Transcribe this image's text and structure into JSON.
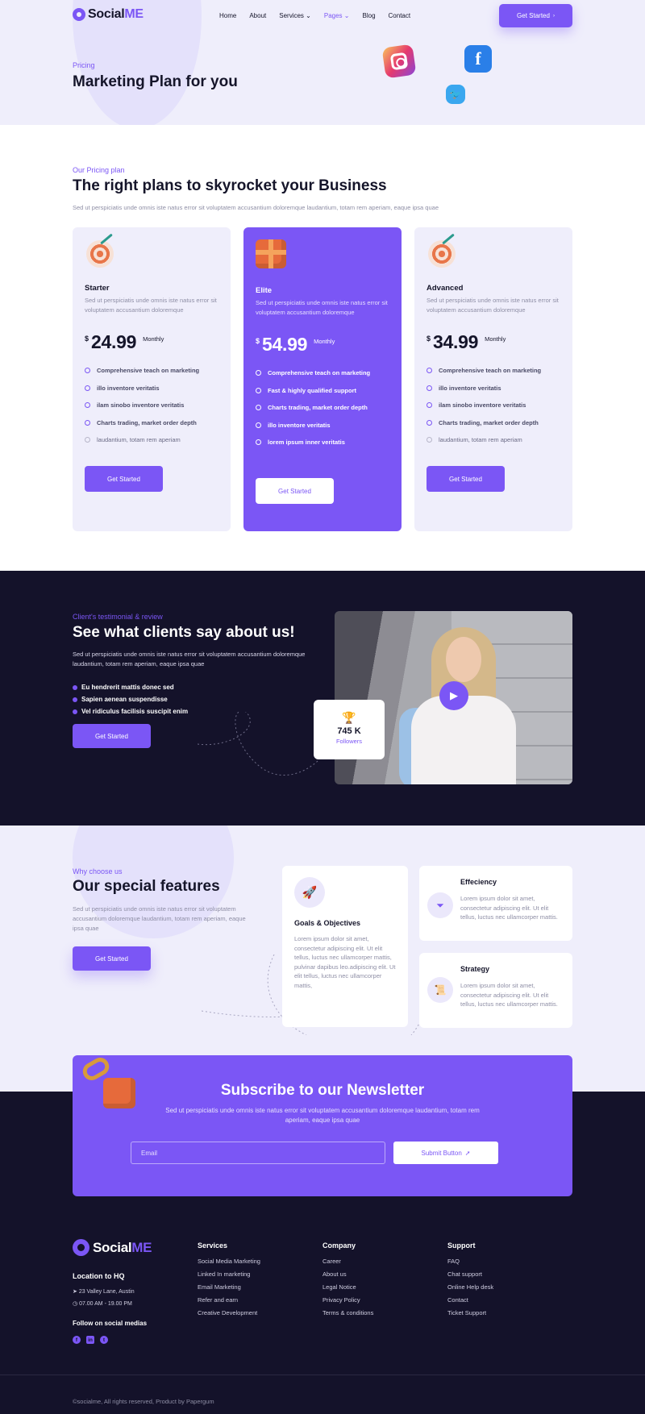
{
  "header": {
    "logo_main": "Social",
    "logo_accent": "ME",
    "menu": [
      "Home",
      "About",
      "Services",
      "Pages",
      "Blog",
      "Contact"
    ],
    "cta": "Get Started"
  },
  "hero": {
    "label": "Pricing",
    "title": "Marketing Plan for you"
  },
  "pricing": {
    "label": "Our Pricing plan",
    "title": "The right plans to skyrocket your Business",
    "subtitle": "Sed ut perspiciatis unde omnis iste natus error sit voluptatem accusantium doloremque laudantium, totam rem aperiam, eaque ipsa quae",
    "plans": [
      {
        "name": "Starter",
        "desc": "Sed ut perspiciatis unde omnis iste natus error sit voluptatem accusantium doloremque",
        "currency": "$",
        "price": "24.99",
        "period": "Monthly",
        "features": [
          "Comprehensive teach on marketing",
          "illo inventore veritatis",
          "ilam sinobo inventore veritatis",
          "Charts trading, market order depth",
          "laudantium, totam rem aperiam"
        ],
        "button": "Get Started"
      },
      {
        "name": "Elite",
        "desc": "Sed ut perspiciatis unde omnis iste natus error sit voluptatem accusantium doloremque",
        "currency": "$",
        "price": "54.99",
        "period": "Monthly",
        "features": [
          "Comprehensive teach on marketing",
          "Fast & highly qualified support",
          "Charts trading, market order depth",
          "illo inventore veritatis",
          "lorem ipsum inner veritatis"
        ],
        "button": "Get Started"
      },
      {
        "name": "Advanced",
        "desc": "Sed ut perspiciatis unde omnis iste natus error sit voluptatem accusantium doloremque",
        "currency": "$",
        "price": "34.99",
        "period": "Monthly",
        "features": [
          "Comprehensive teach on marketing",
          "illo inventore veritatis",
          "ilam sinobo inventore veritatis",
          "Charts trading, market order depth",
          "laudantium, totam rem aperiam"
        ],
        "button": "Get Started"
      }
    ]
  },
  "testimonial": {
    "label": "Client's testimonial & review",
    "title": "See what clients say about us!",
    "subtitle": "Sed ut perspiciatis unde omnis iste natus error sit voluptatem accusantium doloremque laudantium, totam rem aperiam, eaque ipsa quae",
    "bullets": [
      "Eu hendrerit mattis donec sed",
      "Sapien aenean suspendisse",
      "Vel ridiculus facilisis suscipit enim"
    ],
    "button": "Get Started",
    "followers_count": "745 K",
    "followers_label": "Followers"
  },
  "features": {
    "label": "Why choose us",
    "title": "Our special features",
    "subtitle": "Sed ut perspiciatis unde omnis iste natus error sit voluptatem accusantium doloremque laudantium, totam rem aperiam, eaque ipsa quae",
    "button": "Get Started",
    "items": [
      {
        "title": "Goals & Objectives",
        "desc": "Lorem ipsum dolor sit amet, consectetur adipiscing elit. Ut elit tellus, luctus nec ullamcorper mattis, pulvinar dapibus leo.adipiscing elit. Ut elit tellus, luctus nec ullamcorper mattis,"
      },
      {
        "title": "Effeciency",
        "desc": "Lorem ipsum dolor sit amet, consectetur adipiscing elit. Ut elit tellus, luctus nec ullamcorper mattis."
      },
      {
        "title": "Strategy",
        "desc": "Lorem ipsum dolor sit amet, consectetur adipiscing elit. Ut elit tellus, luctus nec ullamcorper mattis."
      }
    ]
  },
  "newsletter": {
    "title": "Subscribe to our Newsletter",
    "subtitle": "Sed ut perspiciatis unde omnis iste natus error sit voluptatem accusantium doloremque laudantium, totam rem aperiam, eaque ipsa quae",
    "placeholder": "Email",
    "button": "Submit Button"
  },
  "footer": {
    "location_title": "Location to HQ",
    "address": "23 Valley Lane, Austin",
    "hours": "07.00 AM - 19.00 PM",
    "follow_title": "Follow on social medias",
    "columns": [
      {
        "title": "Services",
        "links": [
          "Social Media Marketing",
          "Linked In marketing",
          "Email Marketing",
          "Refer and earn",
          "Creative Development"
        ]
      },
      {
        "title": "Company",
        "links": [
          "Career",
          "About us",
          "Legal Notice",
          "Privacy Policy",
          "Terms & conditions"
        ]
      },
      {
        "title": "Support",
        "links": [
          "FAQ",
          "Chat support",
          "Online Help desk",
          "Contact",
          "Ticket Support"
        ]
      }
    ],
    "copyright": "©socialme, All rights reserved, Product by Papergum"
  },
  "colors": {
    "accent": "#7b56f5",
    "dark": "#14122a",
    "light_bg": "#efeefb"
  },
  "icons": [
    "instagram-icon",
    "facebook-icon",
    "twitter-icon",
    "target-icon",
    "gift-box-icon",
    "play-icon",
    "trophy-icon",
    "rocket-icon",
    "filter-icon",
    "scroll-icon",
    "send-icon",
    "linkedin-icon"
  ]
}
